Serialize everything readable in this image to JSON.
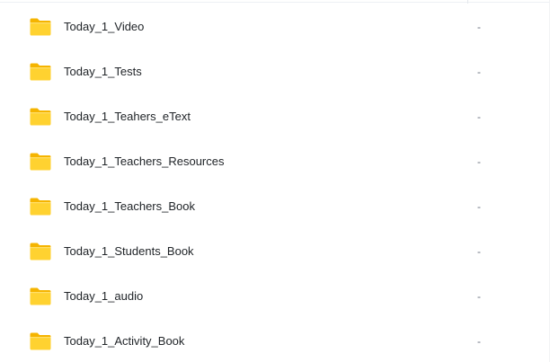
{
  "folder_list": {
    "items": [
      {
        "name": "Today_1_Video",
        "size": "-",
        "icon": "folder-icon"
      },
      {
        "name": "Today_1_Tests",
        "size": "-",
        "icon": "folder-icon"
      },
      {
        "name": "Today_1_Teahers_eText",
        "size": "-",
        "icon": "folder-icon"
      },
      {
        "name": "Today_1_Teachers_Resources",
        "size": "-",
        "icon": "folder-icon"
      },
      {
        "name": "Today_1_Teachers_Book",
        "size": "-",
        "icon": "folder-icon"
      },
      {
        "name": "Today_1_Students_Book",
        "size": "-",
        "icon": "folder-icon"
      },
      {
        "name": "Today_1_audio",
        "size": "-",
        "icon": "folder-icon"
      },
      {
        "name": "Today_1_Activity_Book",
        "size": "-",
        "icon": "folder-icon"
      }
    ]
  },
  "colors": {
    "folder_back": "#f5b400",
    "folder_front": "#ffd230",
    "text": "#212529",
    "muted": "#6b7280"
  }
}
